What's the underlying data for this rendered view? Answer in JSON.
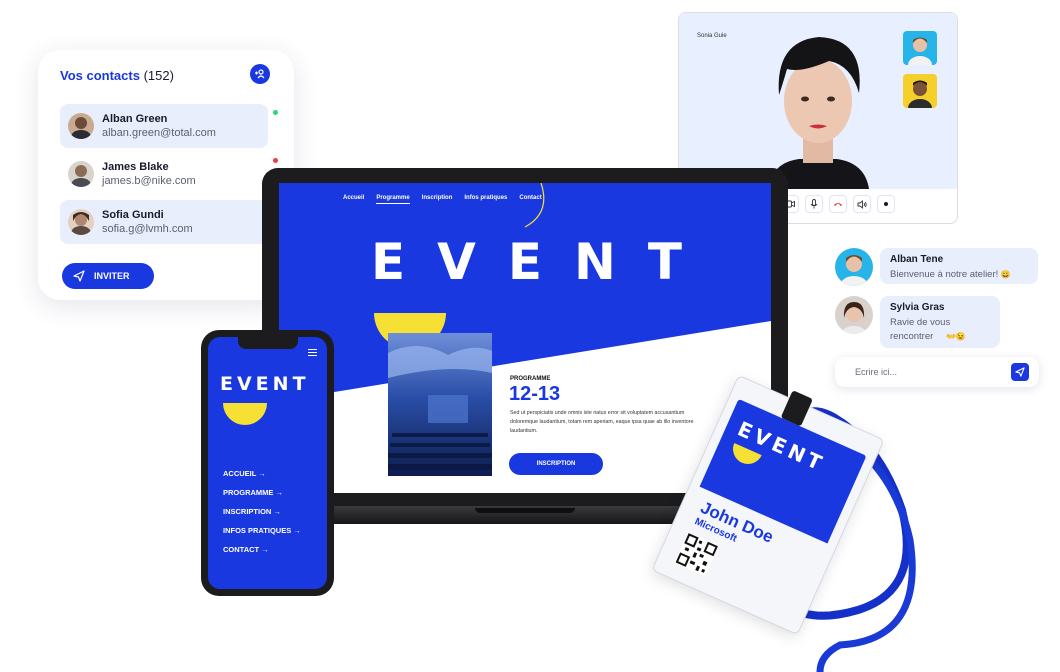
{
  "contacts": {
    "title": "Vos contacts",
    "count": "(152)",
    "add_icon": "add-user-icon",
    "items": [
      {
        "name": "Alban Green",
        "email": "alban.green@total.com",
        "status_color": "#2bd67b"
      },
      {
        "name": "James Blake",
        "email": "james.b@nike.com",
        "status_color": "#f0384a"
      },
      {
        "name": "Sofia Gundi",
        "email": "sofia.g@lvmh.com",
        "status_color": "#1938e0"
      }
    ],
    "invite_label": "INVITER"
  },
  "video_call": {
    "caller_name": "Sonia Guie",
    "controls": [
      "camera-icon",
      "microphone-icon",
      "hangup-icon",
      "volume-icon",
      "more-icon"
    ]
  },
  "chat": {
    "messages": [
      {
        "author": "Alban Tene",
        "text": "Bienvenue à notre atelier!",
        "emoji": "😀"
      },
      {
        "author": "Sylvia Gras",
        "text_line1": "Ravie de vous",
        "text_line2": "rencontrer",
        "emoji": "👐😉"
      }
    ],
    "input_placeholder": "Ecrire ici..."
  },
  "laptop_site": {
    "nav": [
      "Accueil",
      "Programme",
      "Inscription",
      "Infos pratiques",
      "Contact"
    ],
    "active_nav": "Programme",
    "hero_title": "EVENT",
    "section_label": "PROGRAMME",
    "date": "12-13",
    "description": "Sed ut perspiciatis unde omnis iste natus error sit voluptatem accusantium doloremque laudantium, totam rem aperiam, eaque ipsa quae ab illo inventore laudantium.",
    "cta_label": "INSCRIPTION"
  },
  "phone_site": {
    "title": "EVENT",
    "menu": [
      "ACCUEIL →",
      "PROGRAMME →",
      "INSCRIPTION →",
      "INFOS PRATIQUES →",
      "CONTACT →"
    ]
  },
  "badge": {
    "event_label": "EVENT",
    "name": "John Doe",
    "company": "Microsoft"
  },
  "colors": {
    "brand_blue": "#1938e0",
    "accent_yellow": "#f7e034",
    "light_blue": "#e8eefb"
  }
}
